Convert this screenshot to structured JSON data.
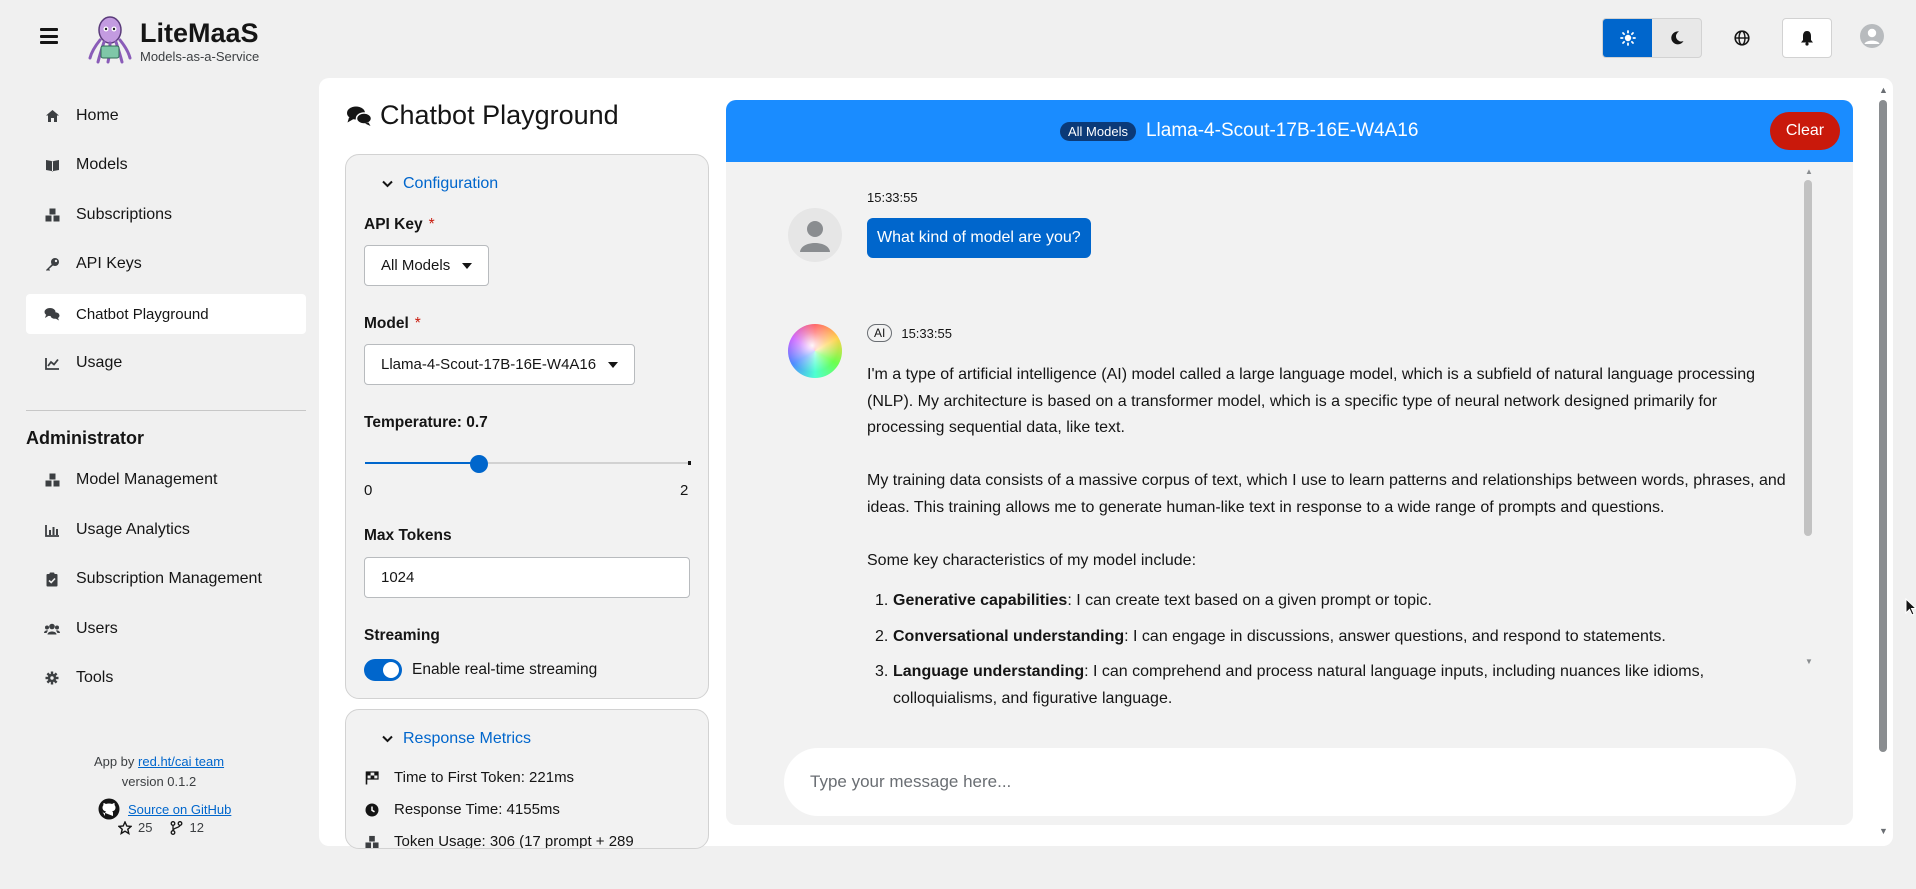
{
  "brand": {
    "name": "LiteMaaS",
    "tagline": "Models-as-a-Service"
  },
  "header": {
    "theme": "light"
  },
  "sidebar": {
    "items": [
      {
        "label": "Home",
        "icon": "home-icon"
      },
      {
        "label": "Models",
        "icon": "book-icon"
      },
      {
        "label": "Subscriptions",
        "icon": "cubes-icon"
      },
      {
        "label": "API Keys",
        "icon": "key-icon"
      },
      {
        "label": "Chatbot Playground",
        "icon": "comments-icon",
        "active": true
      },
      {
        "label": "Usage",
        "icon": "chart-line-icon"
      }
    ],
    "admin_title": "Administrator",
    "admin_items": [
      {
        "label": "Model Management",
        "icon": "cubes-icon"
      },
      {
        "label": "Usage Analytics",
        "icon": "chart-bar-icon"
      },
      {
        "label": "Subscription Management",
        "icon": "clipboard-check-icon"
      },
      {
        "label": "Users",
        "icon": "users-icon"
      },
      {
        "label": "Tools",
        "icon": "cog-icon"
      }
    ],
    "footer": {
      "app_by": "App by",
      "team_link": "red.ht/cai team",
      "version": "version 0.1.2",
      "github_link": "Source on GitHub",
      "stars": "25",
      "forks": "12"
    }
  },
  "page": {
    "title": "Chatbot Playground"
  },
  "config": {
    "section_title": "Configuration",
    "api_key_label": "API Key",
    "api_key_value": "All Models",
    "model_label": "Model",
    "model_value": "Llama-4-Scout-17B-16E-W4A16",
    "temperature_label": "Temperature: 0.7",
    "temperature": {
      "value": 0.7,
      "min": "0",
      "max": "2"
    },
    "max_tokens_label": "Max Tokens",
    "max_tokens_value": "1024",
    "streaming_label": "Streaming",
    "streaming_toggle_label": "Enable real-time streaming",
    "streaming_enabled": true
  },
  "metrics": {
    "section_title": "Response Metrics",
    "rows": [
      {
        "icon": "flag-checkered-icon",
        "text": "Time to First Token: 221ms"
      },
      {
        "icon": "clock-icon",
        "text": "Response Time: 4155ms"
      },
      {
        "icon": "cubes-icon",
        "text": "Token Usage: 306 (17 prompt + 289"
      }
    ]
  },
  "chat": {
    "badge": "All Models",
    "model_name": "Llama-4-Scout-17B-16E-W4A16",
    "clear_label": "Clear",
    "user_message": {
      "time": "15:33:55",
      "text": "What kind of model are you?"
    },
    "ai_message": {
      "label": "AI",
      "time": "15:33:55",
      "paragraphs": [
        "I'm a type of artificial intelligence (AI) model called a large language model, which is a subfield of natural language processing (NLP). My architecture is based on a transformer model, which is a specific type of neural network designed primarily for processing sequential data, like text.",
        "My training data consists of a massive corpus of text, which I use to learn patterns and relationships between words, phrases, and ideas. This training allows me to generate human-like text in response to a wide range of prompts and questions.",
        "Some key characteristics of my model include:"
      ],
      "list": [
        {
          "num": "1.",
          "bold": "Generative capabilities",
          "text": ": I can create text based on a given prompt or topic."
        },
        {
          "num": "2.",
          "bold": "Conversational understanding",
          "text": ": I can engage in discussions, answer questions, and respond to statements."
        },
        {
          "num": "3.",
          "bold": "Language understanding",
          "text": ": I can comprehend and process natural language inputs, including nuances like idioms, colloquialisms, and figurative language."
        }
      ]
    },
    "input_placeholder": "Type your message here..."
  },
  "colors": {
    "primary": "#0066cc",
    "header_blue": "#1a8cff",
    "danger": "#c9190b"
  }
}
